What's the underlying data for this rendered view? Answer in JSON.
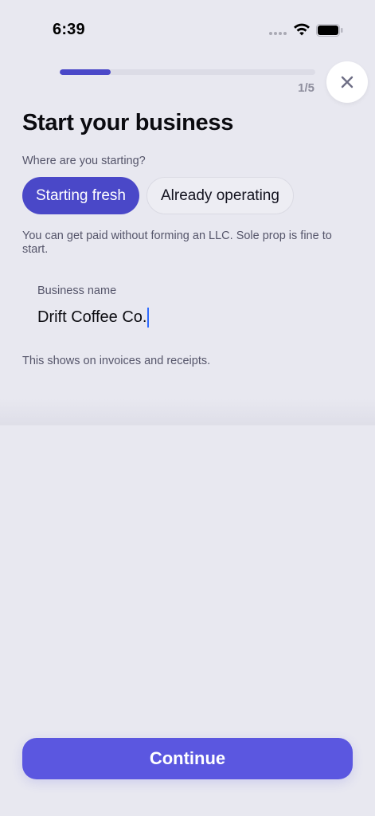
{
  "status_bar": {
    "time": "6:39"
  },
  "progress": {
    "fraction": 0.2,
    "step_label": "1/5"
  },
  "close": {
    "icon": "close-icon"
  },
  "title": "Start your business",
  "question": "Where are you starting?",
  "options": [
    {
      "label": "Starting fresh",
      "selected": true
    },
    {
      "label": "Already operating",
      "selected": false
    }
  ],
  "helper": "You can get paid without forming an LLC. Sole prop is fine to start.",
  "business_name": {
    "label": "Business name",
    "value": "Drift Coffee Co.",
    "hint": "This shows on invoices and receipts."
  },
  "continue_label": "Continue",
  "colors": {
    "accent": "#4a48c8",
    "button": "#5b57e0",
    "background": "#e8e8f0"
  }
}
